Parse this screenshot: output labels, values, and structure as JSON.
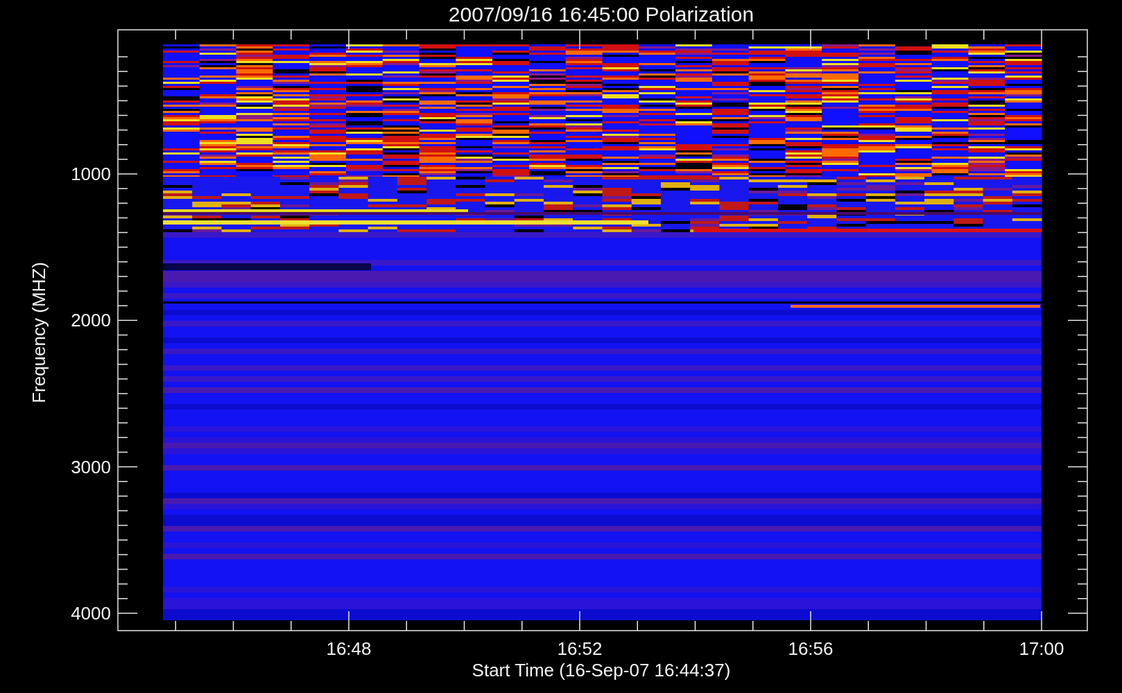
{
  "title": "2007/09/16 16:45:00 Polarization",
  "y_axis": {
    "label": "Frequency (MHZ)",
    "ticks": [
      "1000",
      "2000",
      "3000",
      "4000"
    ]
  },
  "x_axis": {
    "label": "Start Time (16-Sep-07 16:44:37)",
    "ticks": [
      "16:48",
      "16:52",
      "16:56",
      "17:00"
    ]
  }
}
